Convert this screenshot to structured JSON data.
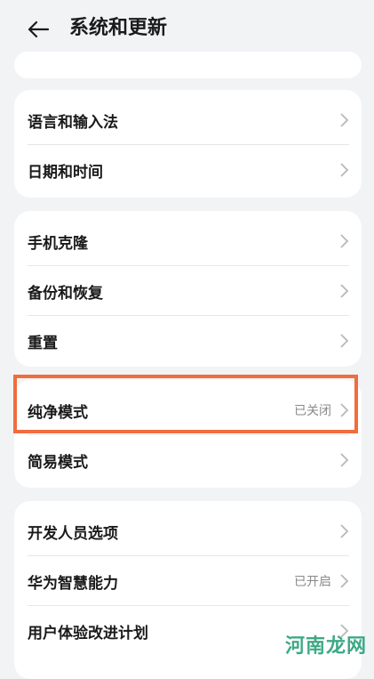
{
  "header": {
    "title": "系统和更新"
  },
  "groups": [
    {
      "items": [
        {
          "label": "语言和输入法"
        },
        {
          "label": "日期和时间"
        }
      ]
    },
    {
      "items": [
        {
          "label": "手机克隆"
        },
        {
          "label": "备份和恢复"
        },
        {
          "label": "重置"
        }
      ]
    },
    {
      "items": [
        {
          "label": "纯净模式",
          "value": "已关闭"
        },
        {
          "label": "简易模式"
        }
      ]
    },
    {
      "items": [
        {
          "label": "开发人员选项"
        },
        {
          "label": "华为智慧能力",
          "value": "已开启"
        },
        {
          "label": "用户体验改进计划"
        }
      ]
    }
  ],
  "watermark": "河南龙网",
  "colors": {
    "highlight": "#f06d3d",
    "background": "#f1f3f5",
    "card": "#ffffff",
    "watermark": "#2aa07a"
  },
  "icons": {
    "back": "arrow-left-icon",
    "chevron": "chevron-right-icon"
  }
}
